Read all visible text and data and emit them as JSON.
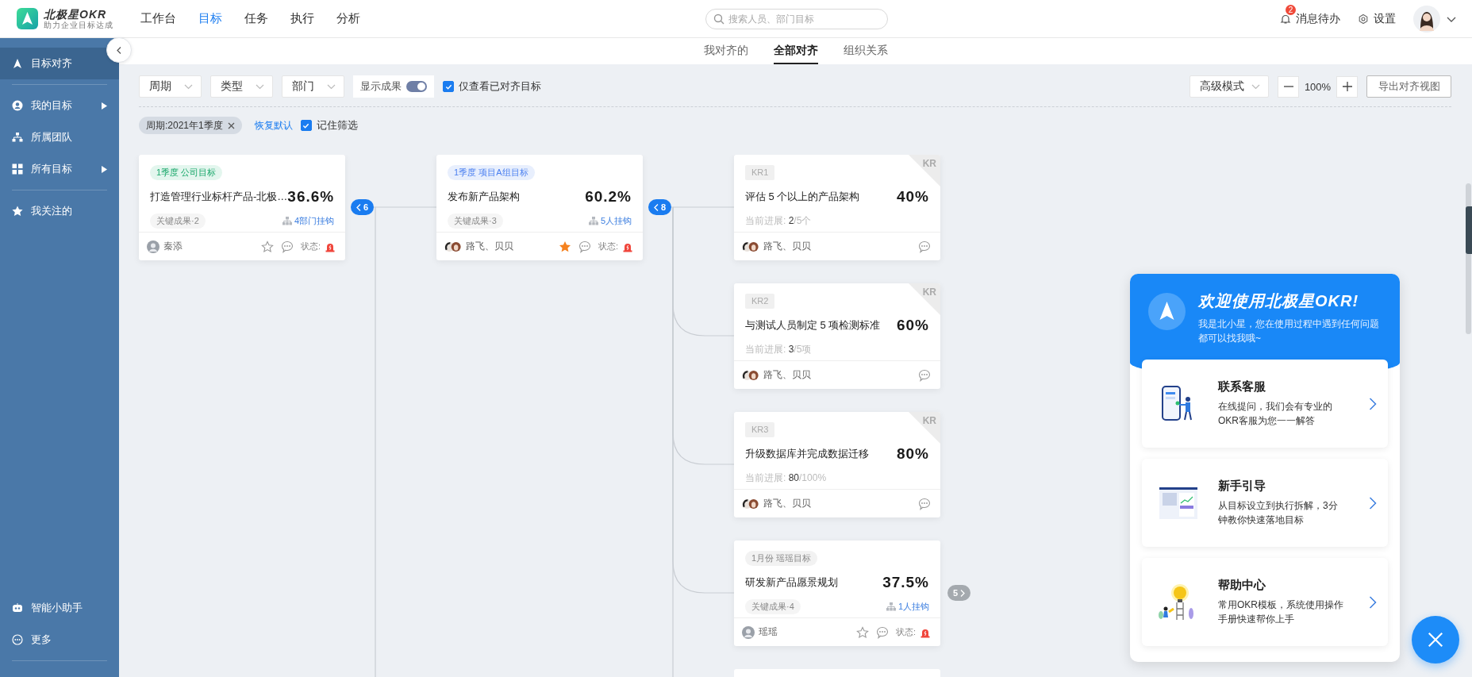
{
  "brand": {
    "name": "北极星OKR",
    "slogan": "助力企业目标达成"
  },
  "nav": [
    {
      "label": "工作台",
      "selected": false
    },
    {
      "label": "目标",
      "selected": true
    },
    {
      "label": "任务",
      "selected": false
    },
    {
      "label": "执行",
      "selected": false
    },
    {
      "label": "分析",
      "selected": false
    }
  ],
  "search": {
    "placeholder": "搜索人员、部门目标"
  },
  "notifications": {
    "label": "消息待办",
    "badge": "2"
  },
  "settings": {
    "label": "设置"
  },
  "sidebar": {
    "groups": [
      [
        {
          "label": "目标对齐",
          "selected": true,
          "expandable": false
        }
      ],
      [
        {
          "label": "我的目标",
          "selected": false,
          "expandable": true
        },
        {
          "label": "所属团队",
          "selected": false,
          "expandable": false
        },
        {
          "label": "所有目标",
          "selected": false,
          "expandable": true
        }
      ],
      [
        {
          "label": "我关注的",
          "selected": false,
          "expandable": false
        }
      ]
    ],
    "bottom_items": [
      {
        "label": "智能小助手"
      },
      {
        "label": "更多"
      }
    ]
  },
  "subtabs": [
    {
      "label": "我对齐的",
      "selected": false
    },
    {
      "label": "全部对齐",
      "selected": true
    },
    {
      "label": "组织关系",
      "selected": false
    }
  ],
  "toolbar": {
    "filters": [
      "周期",
      "类型",
      "部门"
    ],
    "show_results": {
      "label": "显示成果",
      "on": true
    },
    "only_aligned": {
      "label": "仅查看已对齐目标",
      "checked": true
    },
    "mode": "高级模式",
    "zoom": "100%",
    "export": "导出对齐视图"
  },
  "active_filters": {
    "chips": [
      "周期:2021年1季度"
    ],
    "reset": "恢复默认",
    "remember": {
      "label": "记住筛选",
      "checked": true
    }
  },
  "canvas": {
    "columns": [
      {
        "cards": [
          {
            "kind": "objective",
            "tag": {
              "label": "1季度 公司目标",
              "kind": "company"
            },
            "title": "打造管理行业标杆产品-北极…",
            "progress": "36.6%",
            "kr_count": "关键成果·2",
            "links": "4部门挂钩",
            "owners": "秦添",
            "avatar": {
              "kind": "single"
            },
            "starred": false,
            "status": "状态:",
            "children": {
              "count": "6",
              "expanded": true
            }
          }
        ]
      },
      {
        "cards": [
          {
            "kind": "objective",
            "tag": {
              "label": "1季度 项目A组目标",
              "kind": "team"
            },
            "title": "发布新产品架构",
            "progress": "60.2%",
            "kr_count": "关键成果·3",
            "links": "5人挂钩",
            "owners": "路飞、贝贝",
            "avatar": {
              "kind": "pair"
            },
            "starred": true,
            "status": "状态:",
            "children": {
              "count": "8",
              "expanded": true
            }
          }
        ]
      },
      {
        "more_below": true,
        "cards": [
          {
            "kind": "kr",
            "tag": "KR1",
            "corner": "KR",
            "title": "评估 5 个以上的产品架构",
            "progress": "40%",
            "current": "当前进展: **2**/5个",
            "owners": "路飞、贝贝",
            "avatar": {
              "kind": "pair"
            }
          },
          {
            "kind": "kr",
            "tag": "KR2",
            "corner": "KR",
            "title": "与测试人员制定 5 项检测标准",
            "progress": "60%",
            "current": "当前进展: **3**/5项",
            "owners": "路飞、贝贝",
            "avatar": {
              "kind": "pair"
            }
          },
          {
            "kind": "kr",
            "tag": "KR3",
            "corner": "KR",
            "title": "升级数据库并完成数据迁移",
            "progress": "80%",
            "current": "当前进展: **80**/100%",
            "owners": "路飞、贝贝",
            "avatar": {
              "kind": "pair"
            }
          },
          {
            "kind": "objective",
            "tag": {
              "label": "1月份 瑶瑶目标",
              "kind": "personal"
            },
            "title": "研发新产品愿景规划",
            "progress": "37.5%",
            "kr_count": "关键成果·4",
            "links": "1人挂钩",
            "owners": "瑶瑶",
            "avatar": {
              "kind": "single"
            },
            "starred": false,
            "status": "状态:",
            "children": {
              "count": "5",
              "expanded": false
            }
          }
        ]
      }
    ]
  },
  "assistant": {
    "title": "欢迎使用北极星OKR!",
    "subtitle": "我是北小星，您在使用过程中遇到任何问题都可以找我哦~",
    "cards": [
      {
        "title": "联系客服",
        "text": "在线提问，我们会有专业的OKR客服为您一一解答"
      },
      {
        "title": "新手引导",
        "text": "从目标设立到执行拆解，3分钟教你快速落地目标"
      },
      {
        "title": "帮助中心",
        "text": "常用OKR模板，系统使用操作手册快速帮你上手"
      }
    ]
  }
}
